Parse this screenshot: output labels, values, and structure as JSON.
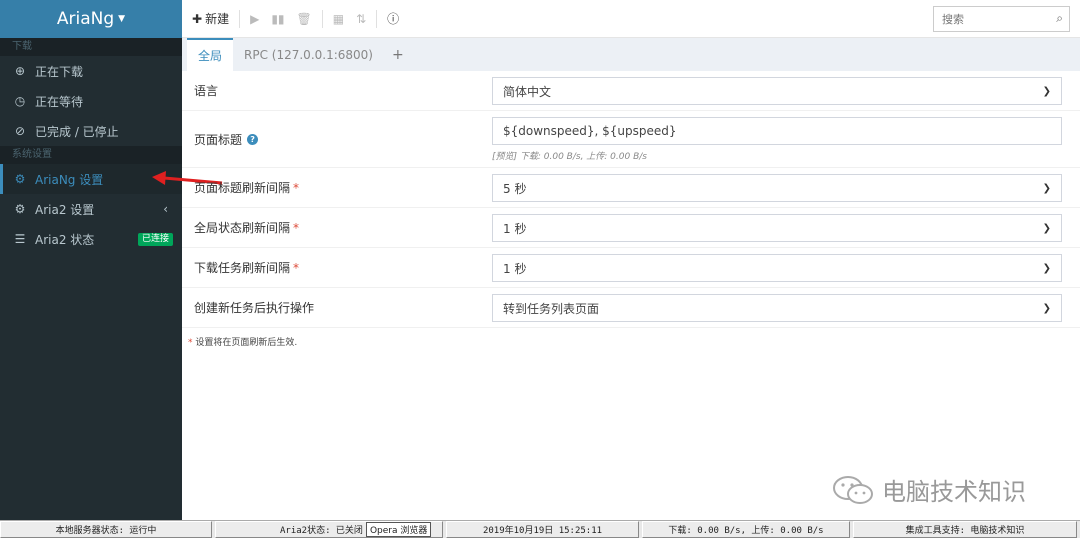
{
  "sidebar": {
    "brand": "AriaNg",
    "section_download": "下载",
    "items_download": [
      {
        "label": "正在下载",
        "icon": "download-circle-icon"
      },
      {
        "label": "正在等待",
        "icon": "clock-icon"
      },
      {
        "label": "已完成 / 已停止",
        "icon": "check-circle-icon"
      }
    ],
    "section_settings": "系统设置",
    "items_settings": [
      {
        "label": "AriaNg 设置",
        "icon": "gear-icon",
        "active": true
      },
      {
        "label": "Aria2 设置",
        "icon": "gears-icon"
      },
      {
        "label": "Aria2 状态",
        "icon": "server-icon",
        "badge": "已连接"
      }
    ]
  },
  "toolbar": {
    "new_label": "新建",
    "search_placeholder": "搜索"
  },
  "tabs": [
    {
      "label": "全局",
      "active": true
    },
    {
      "label": "RPC (127.0.0.1:6800)"
    }
  ],
  "settings": {
    "language": {
      "label": "语言",
      "value": "简体中文"
    },
    "page_title": {
      "label": "页面标题",
      "value": "${downspeed}, ${upspeed}",
      "hint": "[预览] 下载: 0.00 B/s, 上传: 0.00 B/s"
    },
    "title_refresh": {
      "label": "页面标题刷新间隔",
      "required_mark": "*",
      "value": "5 秒"
    },
    "global_refresh": {
      "label": "全局状态刷新间隔",
      "required_mark": "*",
      "value": "1 秒"
    },
    "task_refresh": {
      "label": "下载任务刷新间隔",
      "required_mark": "*",
      "value": "1 秒"
    },
    "after_create": {
      "label": "创建新任务后执行操作",
      "value": "转到任务列表页面"
    },
    "footnote_mark": "*",
    "footnote": "设置将在页面刷新后生效."
  },
  "watermark": "电脑技术知识",
  "statusbar": {
    "server_status": "本地服务器状态: 运行中",
    "aria2_status": "Aria2状态: 已关闭",
    "browser": "Opera 浏览器",
    "datetime": "2019年10月19日 15:25:11",
    "speed": "下载: 0.00 B/s, 上传: 0.00 B/s",
    "support": "集成工具支持: 电脑技术知识"
  },
  "colors": {
    "sidebar_bg": "#222d32",
    "brand_bg": "#367fa9",
    "accent": "#3c8dbc",
    "badge_green": "#00a65a",
    "required_red": "#dd4b39"
  }
}
